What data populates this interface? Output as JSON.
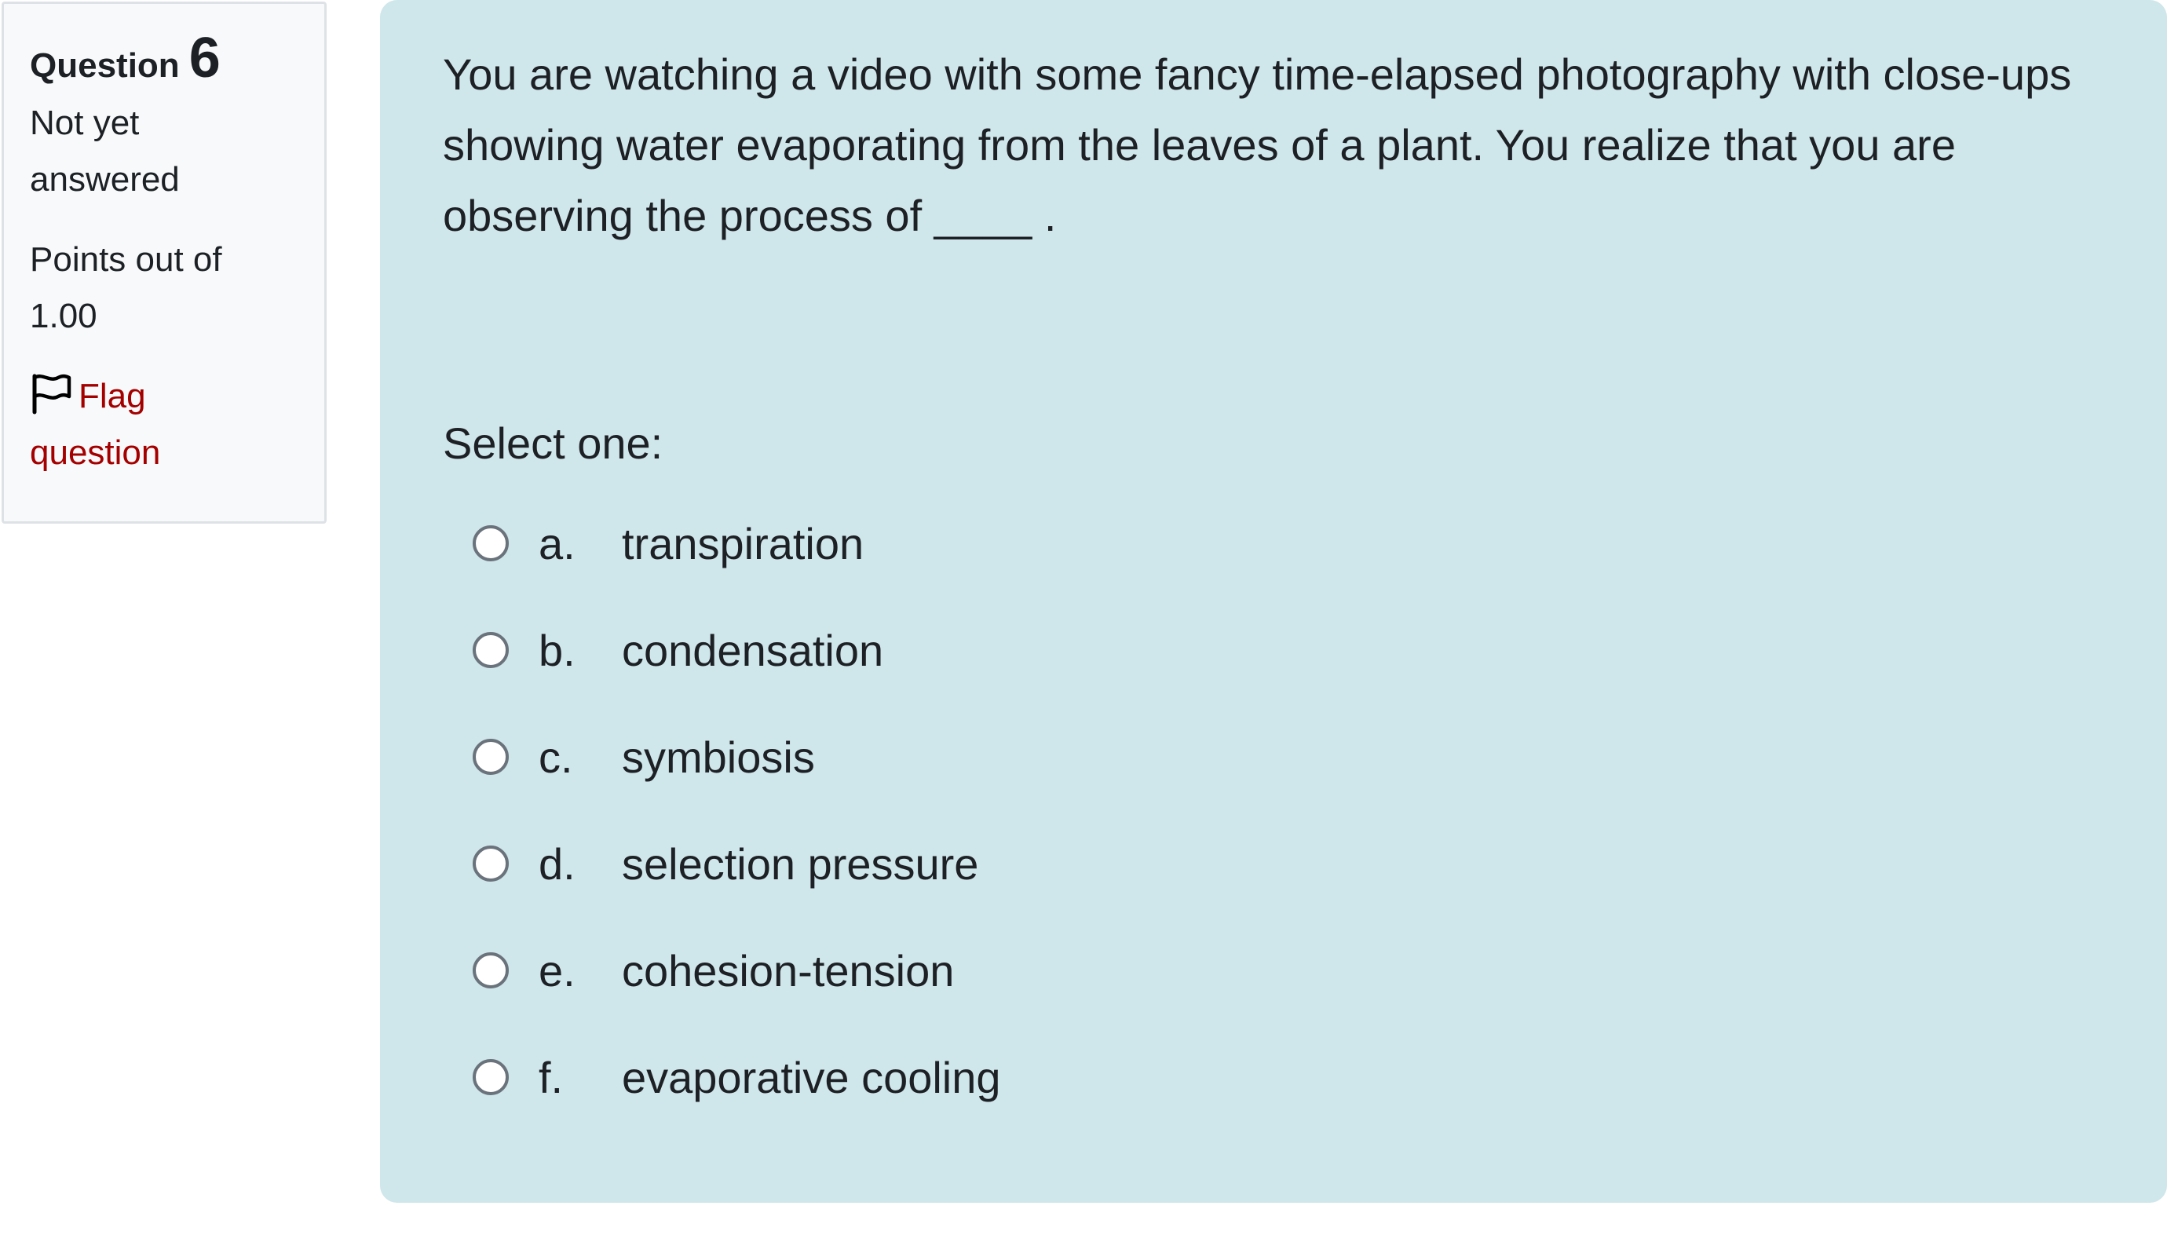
{
  "info": {
    "question_label": "Question",
    "question_number": "6",
    "state": "Not yet answered",
    "grade": "Points out of 1.00",
    "flag_label": "Flag question"
  },
  "question": {
    "text": "You are watching a video with some fancy time-elapsed photography with close-ups showing water evaporating from the leaves of a plant.  You realize that you are observing the process of ____ .",
    "prompt": "Select one:",
    "answers": [
      {
        "letter": "a.",
        "text": "transpiration",
        "selected": false
      },
      {
        "letter": "b.",
        "text": "condensation",
        "selected": false
      },
      {
        "letter": "c.",
        "text": "symbiosis",
        "selected": false
      },
      {
        "letter": "d.",
        "text": "selection pressure",
        "selected": false
      },
      {
        "letter": "e.",
        "text": "cohesion-tension",
        "selected": false
      },
      {
        "letter": "f.",
        "text": "evaporative cooling",
        "selected": false
      }
    ]
  },
  "colors": {
    "content_background": "#cfe6ea",
    "info_background": "#f8f9fa",
    "flag_link": "#a40000"
  },
  "icons": {
    "flag": "flag-outline-icon",
    "radio": "radio-unchecked-icon"
  }
}
